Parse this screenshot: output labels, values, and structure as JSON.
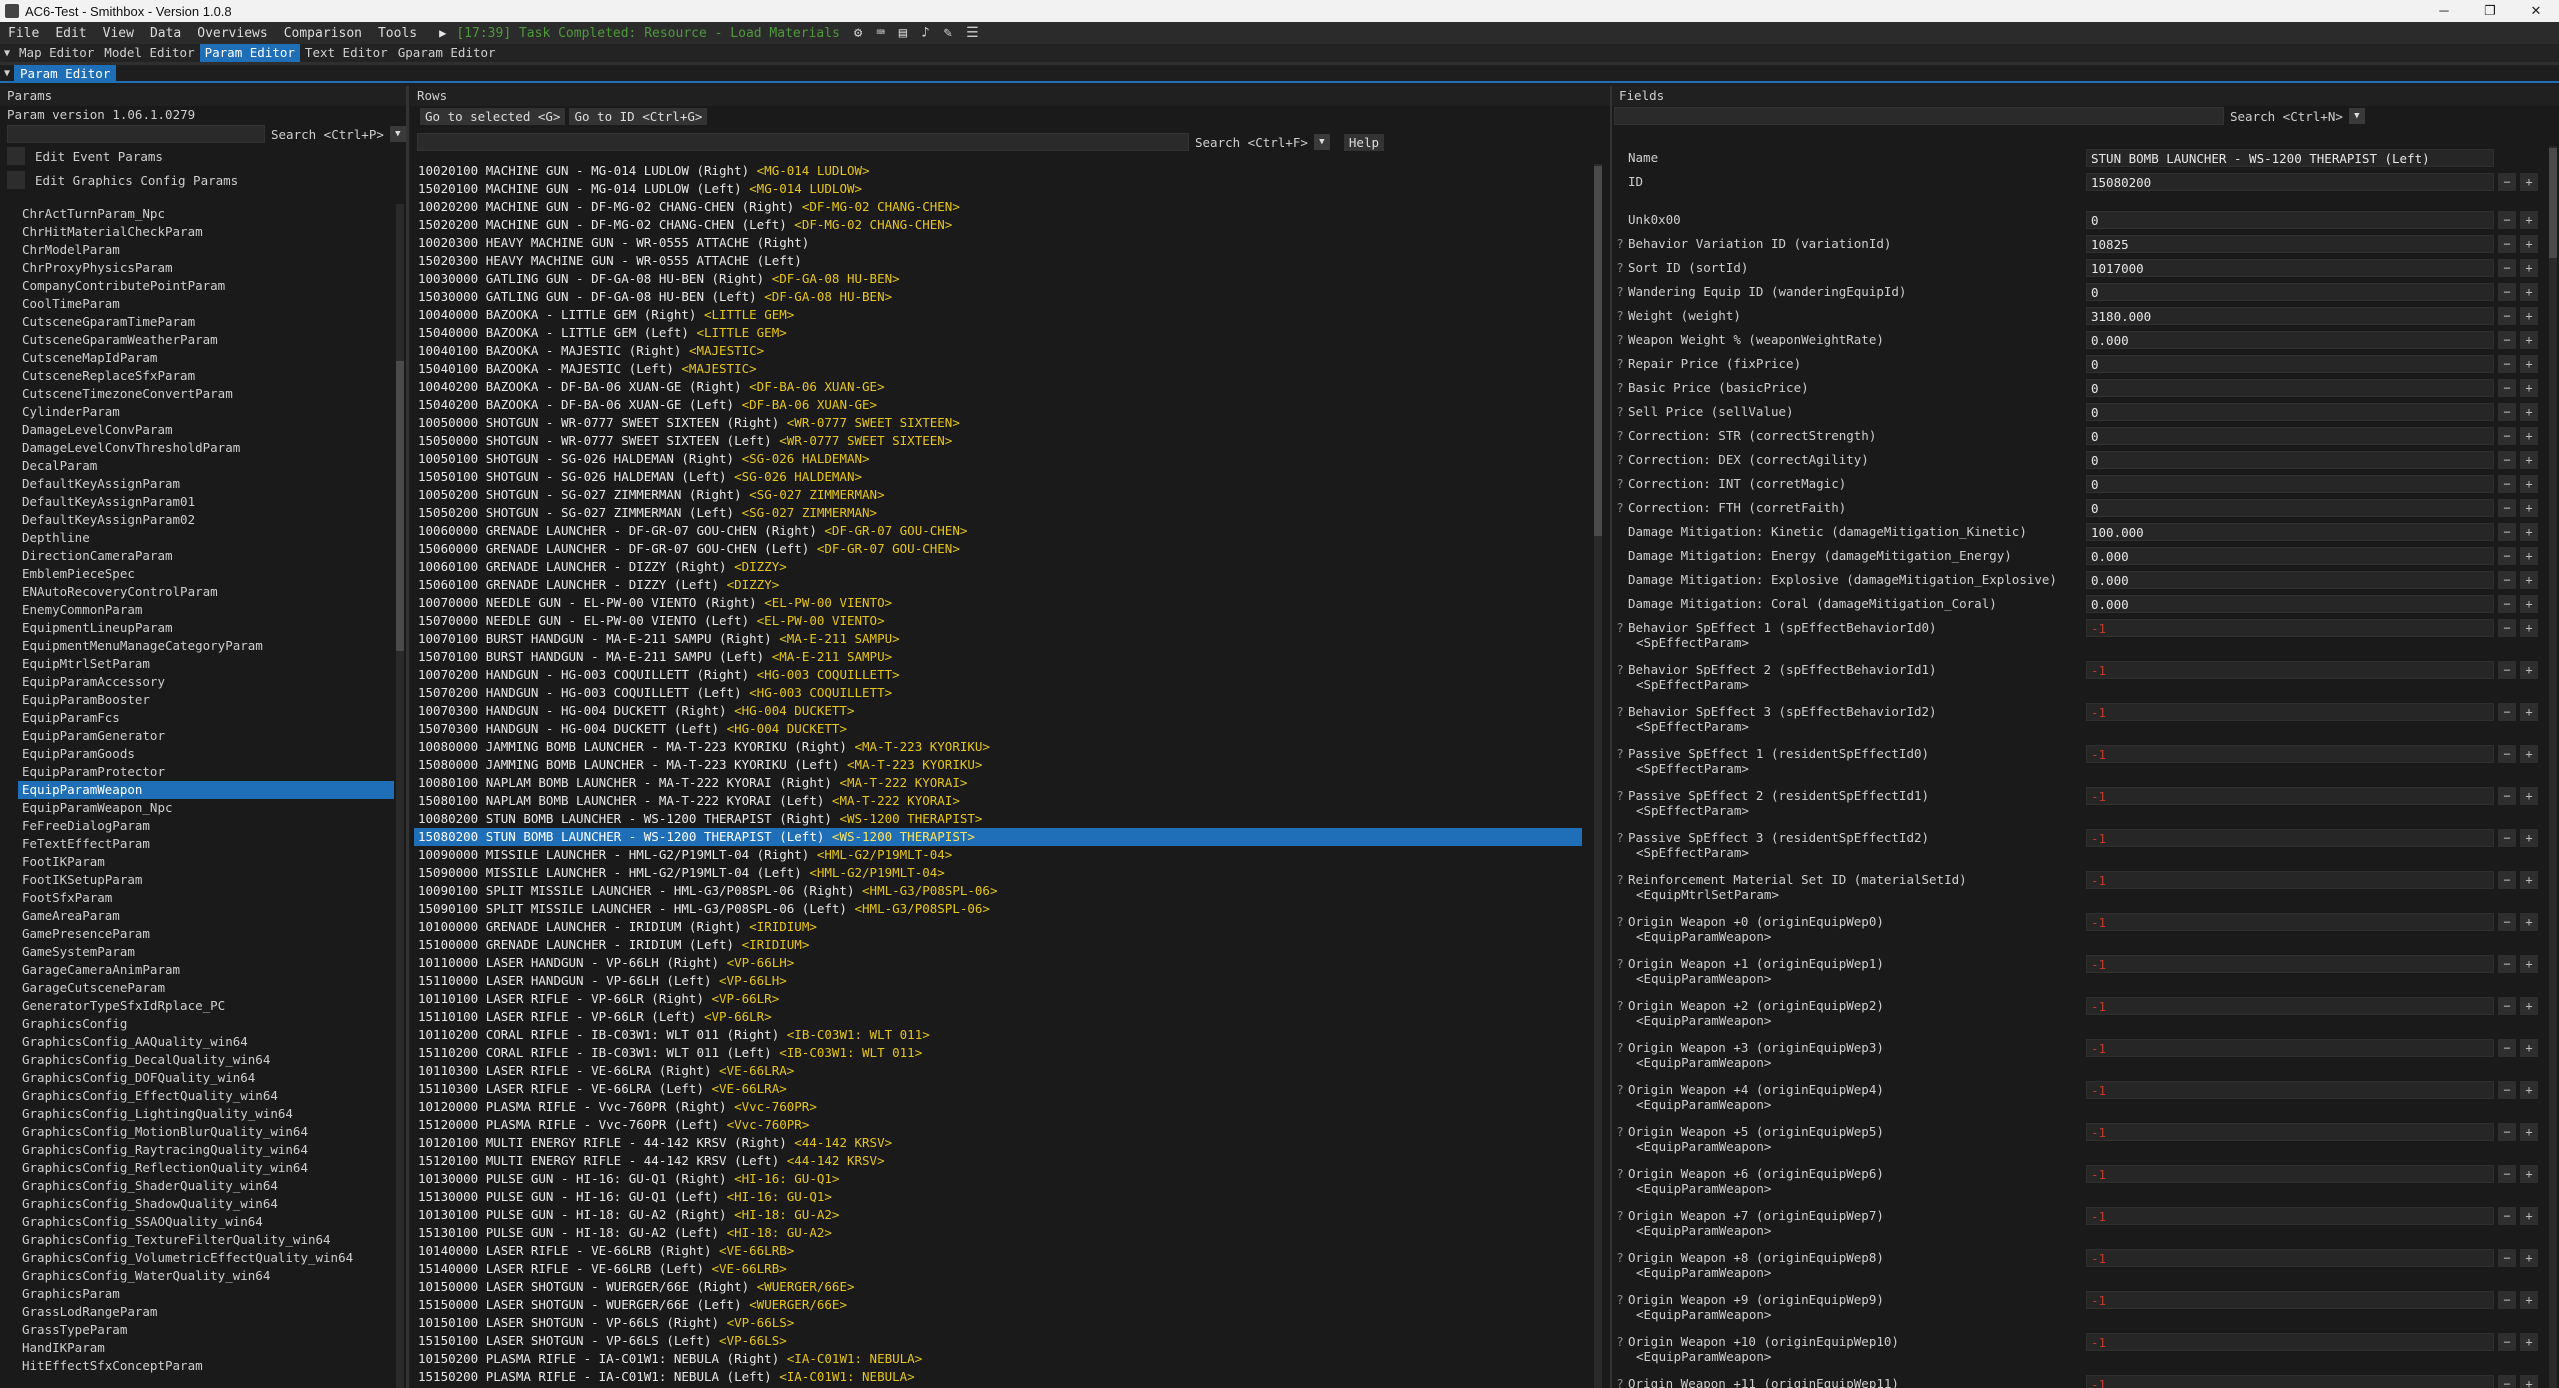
{
  "window": {
    "title": "AC6-Test - Smithbox - Version 1.0.8"
  },
  "menu": {
    "items": [
      "File",
      "Edit",
      "View",
      "Data",
      "Overviews",
      "Comparison",
      "Tools"
    ],
    "status": "[17:39] Task Completed: Resource - Load Materials"
  },
  "editors": {
    "tabs": [
      "Map Editor",
      "Model Editor",
      "Param Editor",
      "Text Editor",
      "Gparam Editor"
    ],
    "active": "Param Editor"
  },
  "subtab": "Param Editor",
  "params": {
    "title": "Params",
    "version": "Param version 1.06.1.0279",
    "search_label": "Search <Ctrl+P>",
    "edit_event": "Edit Event Params",
    "edit_graphics": "Edit Graphics Config Params",
    "items": [
      "ChrActTurnParam_Npc",
      "ChrHitMaterialCheckParam",
      "ChrModelParam",
      "ChrProxyPhysicsParam",
      "CompanyContributePointParam",
      "CoolTimeParam",
      "CutsceneGparamTimeParam",
      "CutsceneGparamWeatherParam",
      "CutsceneMapIdParam",
      "CutsceneReplaceSfxParam",
      "CutsceneTimezoneConvertParam",
      "CylinderParam",
      "DamageLevelConvParam",
      "DamageLevelConvThresholdParam",
      "DecalParam",
      "DefaultKeyAssignParam",
      "DefaultKeyAssignParam01",
      "DefaultKeyAssignParam02",
      "Depthline",
      "DirectionCameraParam",
      "EmblemPieceSpec",
      "ENAutoRecoveryControlParam",
      "EnemyCommonParam",
      "EquipmentLineupParam",
      "EquipmentMenuManageCategoryParam",
      "EquipMtrlSetParam",
      "EquipParamAccessory",
      "EquipParamBooster",
      "EquipParamFcs",
      "EquipParamGenerator",
      "EquipParamGoods",
      "EquipParamProtector",
      "EquipParamWeapon",
      "EquipParamWeapon_Npc",
      "FeFreeDialogParam",
      "FeTextEffectParam",
      "FootIKParam",
      "FootIKSetupParam",
      "FootSfxParam",
      "GameAreaParam",
      "GamePresenceParam",
      "GameSystemParam",
      "GarageCameraAnimParam",
      "GarageCutsceneParam",
      "GeneratorTypeSfxIdRplace_PC",
      "GraphicsConfig",
      "GraphicsConfig_AAQuality_win64",
      "GraphicsConfig_DecalQuality_win64",
      "GraphicsConfig_DOFQuality_win64",
      "GraphicsConfig_EffectQuality_win64",
      "GraphicsConfig_LightingQuality_win64",
      "GraphicsConfig_MotionBlurQuality_win64",
      "GraphicsConfig_RaytracingQuality_win64",
      "GraphicsConfig_ReflectionQuality_win64",
      "GraphicsConfig_ShaderQuality_win64",
      "GraphicsConfig_ShadowQuality_win64",
      "GraphicsConfig_SSAOQuality_win64",
      "GraphicsConfig_TextureFilterQuality_win64",
      "GraphicsConfig_VolumetricEffectQuality_win64",
      "GraphicsConfig_WaterQuality_win64",
      "GraphicsParam",
      "GrassLodRangeParam",
      "GrassTypeParam",
      "HandIKParam",
      "HitEffectSfxConceptParam"
    ],
    "selected": "EquipParamWeapon"
  },
  "rows": {
    "title": "Rows",
    "goto_selected": "Go to selected <G>",
    "goto_id": "Go to ID <Ctrl+G>",
    "search_label": "Search <Ctrl+F>",
    "help": "Help",
    "selected_index": 37,
    "items": [
      [
        "10020100 MACHINE GUN - MG-014 LUDLOW (Right)",
        "<MG-014 LUDLOW>"
      ],
      [
        "15020100 MACHINE GUN - MG-014 LUDLOW (Left)",
        "<MG-014 LUDLOW>"
      ],
      [
        "10020200 MACHINE GUN - DF-MG-02 CHANG-CHEN (Right)",
        "<DF-MG-02 CHANG-CHEN>"
      ],
      [
        "15020200 MACHINE GUN - DF-MG-02 CHANG-CHEN (Left)",
        "<DF-MG-02 CHANG-CHEN>"
      ],
      [
        "10020300 HEAVY MACHINE GUN - WR-0555 ATTACHE (Right)",
        ""
      ],
      [
        "15020300 HEAVY MACHINE GUN - WR-0555 ATTACHE (Left)",
        ""
      ],
      [
        "10030000 GATLING GUN - DF-GA-08 HU-BEN (Right)",
        "<DF-GA-08 HU-BEN>"
      ],
      [
        "15030000 GATLING GUN - DF-GA-08 HU-BEN (Left)",
        "<DF-GA-08 HU-BEN>"
      ],
      [
        "10040000 BAZOOKA - LITTLE GEM (Right)",
        "<LITTLE GEM>"
      ],
      [
        "15040000 BAZOOKA - LITTLE GEM (Left)",
        "<LITTLE GEM>"
      ],
      [
        "10040100 BAZOOKA - MAJESTIC (Right)",
        "<MAJESTIC>"
      ],
      [
        "15040100 BAZOOKA - MAJESTIC (Left)",
        "<MAJESTIC>"
      ],
      [
        "10040200 BAZOOKA - DF-BA-06 XUAN-GE (Right)",
        "<DF-BA-06 XUAN-GE>"
      ],
      [
        "15040200 BAZOOKA - DF-BA-06 XUAN-GE (Left)",
        "<DF-BA-06 XUAN-GE>"
      ],
      [
        "10050000 SHOTGUN - WR-0777 SWEET SIXTEEN (Right)",
        "<WR-0777 SWEET SIXTEEN>"
      ],
      [
        "15050000 SHOTGUN - WR-0777 SWEET SIXTEEN (Left)",
        "<WR-0777 SWEET SIXTEEN>"
      ],
      [
        "10050100 SHOTGUN - SG-026 HALDEMAN (Right)",
        "<SG-026 HALDEMAN>"
      ],
      [
        "15050100 SHOTGUN - SG-026 HALDEMAN (Left)",
        "<SG-026 HALDEMAN>"
      ],
      [
        "10050200 SHOTGUN - SG-027 ZIMMERMAN (Right)",
        "<SG-027 ZIMMERMAN>"
      ],
      [
        "15050200 SHOTGUN - SG-027 ZIMMERMAN (Left)",
        "<SG-027 ZIMMERMAN>"
      ],
      [
        "10060000 GRENADE LAUNCHER - DF-GR-07 GOU-CHEN (Right)",
        "<DF-GR-07 GOU-CHEN>"
      ],
      [
        "15060000 GRENADE LAUNCHER - DF-GR-07 GOU-CHEN (Left)",
        "<DF-GR-07 GOU-CHEN>"
      ],
      [
        "10060100 GRENADE LAUNCHER - DIZZY (Right)",
        "<DIZZY>"
      ],
      [
        "15060100 GRENADE LAUNCHER - DIZZY (Left)",
        "<DIZZY>"
      ],
      [
        "10070000 NEEDLE GUN - EL-PW-00 VIENTO (Right)",
        "<EL-PW-00 VIENTO>"
      ],
      [
        "15070000 NEEDLE GUN - EL-PW-00 VIENTO (Left)",
        "<EL-PW-00 VIENTO>"
      ],
      [
        "10070100 BURST HANDGUN - MA-E-211 SAMPU (Right)",
        "<MA-E-211 SAMPU>"
      ],
      [
        "15070100 BURST HANDGUN - MA-E-211 SAMPU (Left)",
        "<MA-E-211 SAMPU>"
      ],
      [
        "10070200 HANDGUN - HG-003 COQUILLETT (Right)",
        "<HG-003 COQUILLETT>"
      ],
      [
        "15070200 HANDGUN - HG-003 COQUILLETT (Left)",
        "<HG-003 COQUILLETT>"
      ],
      [
        "10070300 HANDGUN - HG-004 DUCKETT (Right)",
        "<HG-004 DUCKETT>"
      ],
      [
        "15070300 HANDGUN - HG-004 DUCKETT (Left)",
        "<HG-004 DUCKETT>"
      ],
      [
        "10080000 JAMMING BOMB LAUNCHER - MA-T-223 KYORIKU (Right)",
        "<MA-T-223 KYORIKU>"
      ],
      [
        "15080000 JAMMING BOMB LAUNCHER - MA-T-223 KYORIKU (Left)",
        "<MA-T-223 KYORIKU>"
      ],
      [
        "10080100 NAPLAM BOMB LAUNCHER - MA-T-222 KYORAI (Right)",
        "<MA-T-222 KYORAI>"
      ],
      [
        "15080100 NAPLAM BOMB LAUNCHER - MA-T-222 KYORAI (Left)",
        "<MA-T-222 KYORAI>"
      ],
      [
        "10080200 STUN BOMB LAUNCHER - WS-1200 THERAPIST (Right)",
        "<WS-1200 THERAPIST>"
      ],
      [
        "15080200 STUN BOMB LAUNCHER - WS-1200 THERAPIST (Left)",
        "<WS-1200 THERAPIST>"
      ],
      [
        "10090000 MISSILE LAUNCHER - HML-G2/P19MLT-04 (Right)",
        "<HML-G2/P19MLT-04>"
      ],
      [
        "15090000 MISSILE LAUNCHER - HML-G2/P19MLT-04 (Left)",
        "<HML-G2/P19MLT-04>"
      ],
      [
        "10090100 SPLIT MISSILE LAUNCHER - HML-G3/P08SPL-06 (Right)",
        "<HML-G3/P08SPL-06>"
      ],
      [
        "15090100 SPLIT MISSILE LAUNCHER - HML-G3/P08SPL-06 (Left)",
        "<HML-G3/P08SPL-06>"
      ],
      [
        "10100000 GRENADE LAUNCHER - IRIDIUM (Right)",
        "<IRIDIUM>"
      ],
      [
        "15100000 GRENADE LAUNCHER - IRIDIUM (Left)",
        "<IRIDIUM>"
      ],
      [
        "10110000 LASER HANDGUN - VP-66LH (Right)",
        "<VP-66LH>"
      ],
      [
        "15110000 LASER HANDGUN - VP-66LH (Left)",
        "<VP-66LH>"
      ],
      [
        "10110100 LASER RIFLE - VP-66LR (Right)",
        "<VP-66LR>"
      ],
      [
        "15110100 LASER RIFLE - VP-66LR (Left)",
        "<VP-66LR>"
      ],
      [
        "10110200 CORAL RIFLE - IB-C03W1: WLT 011 (Right)",
        "<IB-C03W1: WLT 011>"
      ],
      [
        "15110200 CORAL RIFLE - IB-C03W1: WLT 011 (Left)",
        "<IB-C03W1: WLT 011>"
      ],
      [
        "10110300 LASER RIFLE - VE-66LRA (Right)",
        "<VE-66LRA>"
      ],
      [
        "15110300 LASER RIFLE - VE-66LRA (Left)",
        "<VE-66LRA>"
      ],
      [
        "10120000 PLASMA RIFLE - Vvc-760PR (Right)",
        "<Vvc-760PR>"
      ],
      [
        "15120000 PLASMA RIFLE - Vvc-760PR (Left)",
        "<Vvc-760PR>"
      ],
      [
        "10120100 MULTI ENERGY RIFLE - 44-142 KRSV (Right)",
        "<44-142 KRSV>"
      ],
      [
        "15120100 MULTI ENERGY RIFLE - 44-142 KRSV (Left)",
        "<44-142 KRSV>"
      ],
      [
        "10130000 PULSE GUN - HI-16: GU-Q1 (Right)",
        "<HI-16: GU-Q1>"
      ],
      [
        "15130000 PULSE GUN - HI-16: GU-Q1 (Left)",
        "<HI-16: GU-Q1>"
      ],
      [
        "10130100 PULSE GUN - HI-18: GU-A2 (Right)",
        "<HI-18: GU-A2>"
      ],
      [
        "15130100 PULSE GUN - HI-18: GU-A2 (Left)",
        "<HI-18: GU-A2>"
      ],
      [
        "10140000 LASER RIFLE - VE-66LRB (Right)",
        "<VE-66LRB>"
      ],
      [
        "15140000 LASER RIFLE - VE-66LRB (Left)",
        "<VE-66LRB>"
      ],
      [
        "10150000 LASER SHOTGUN - WUERGER/66E (Right)",
        "<WUERGER/66E>"
      ],
      [
        "15150000 LASER SHOTGUN - WUERGER/66E (Left)",
        "<WUERGER/66E>"
      ],
      [
        "10150100 LASER SHOTGUN - VP-66LS (Right)",
        "<VP-66LS>"
      ],
      [
        "15150100 LASER SHOTGUN - VP-66LS (Left)",
        "<VP-66LS>"
      ],
      [
        "10150200 PLASMA RIFLE - IA-C01W1: NEBULA (Right)",
        "<IA-C01W1: NEBULA>"
      ],
      [
        "15150200 PLASMA RIFLE - IA-C01W1: NEBULA (Left)",
        "<IA-C01W1: NEBULA>"
      ]
    ]
  },
  "fields": {
    "title": "Fields",
    "search_label": "Search <Ctrl+N>",
    "items": [
      {
        "q": "",
        "name": "Name",
        "sub": "",
        "value": "STUN BOMB LAUNCHER - WS-1200 THERAPIST (Left)",
        "btns": false
      },
      {
        "q": "",
        "name": "ID",
        "sub": "",
        "value": "15080200",
        "btns": true
      },
      {
        "q": "",
        "name": "",
        "sub": "",
        "value": "",
        "btns": false,
        "spacer": true
      },
      {
        "q": "",
        "name": "Unk0x00",
        "sub": "",
        "value": "0",
        "btns": true
      },
      {
        "q": "?",
        "name": "Behavior Variation ID (variationId)",
        "sub": "",
        "value": "10825",
        "btns": true
      },
      {
        "q": "?",
        "name": "Sort ID (sortId)",
        "sub": "",
        "value": "1017000",
        "btns": true
      },
      {
        "q": "?",
        "name": "Wandering Equip ID (wanderingEquipId)",
        "sub": "",
        "value": "0",
        "btns": true
      },
      {
        "q": "?",
        "name": "Weight (weight)",
        "sub": "",
        "value": "3180.000",
        "btns": true
      },
      {
        "q": "?",
        "name": "Weapon Weight % (weaponWeightRate)",
        "sub": "",
        "value": "0.000",
        "btns": true
      },
      {
        "q": "?",
        "name": "Repair Price (fixPrice)",
        "sub": "",
        "value": "0",
        "btns": true
      },
      {
        "q": "?",
        "name": "Basic Price (basicPrice)",
        "sub": "",
        "value": "0",
        "btns": true
      },
      {
        "q": "?",
        "name": "Sell Price (sellValue)",
        "sub": "",
        "value": "0",
        "btns": true
      },
      {
        "q": "?",
        "name": "Correction: STR (correctStrength)",
        "sub": "",
        "value": "0",
        "btns": true
      },
      {
        "q": "?",
        "name": "Correction: DEX (correctAgility)",
        "sub": "",
        "value": "0",
        "btns": true
      },
      {
        "q": "?",
        "name": "Correction: INT (corretMagic)",
        "sub": "",
        "value": "0",
        "btns": true
      },
      {
        "q": "?",
        "name": "Correction: FTH (corretFaith)",
        "sub": "",
        "value": "0",
        "btns": true
      },
      {
        "q": "",
        "name": "Damage Mitigation: Kinetic (damageMitigation_Kinetic)",
        "sub": "",
        "value": "100.000",
        "btns": true
      },
      {
        "q": "",
        "name": "Damage Mitigation: Energy (damageMitigation_Energy)",
        "sub": "",
        "value": "0.000",
        "btns": true
      },
      {
        "q": "",
        "name": "Damage Mitigation: Explosive (damageMitigation_Explosive)",
        "sub": "",
        "value": "0.000",
        "btns": true
      },
      {
        "q": "",
        "name": "Damage Mitigation: Coral (damageMitigation_Coral)",
        "sub": "",
        "value": "0.000",
        "btns": true
      },
      {
        "q": "?",
        "name": "Behavior SpEffect 1 (spEffectBehaviorId0)",
        "sub": "<SpEffectParam>",
        "value": "-1",
        "btns": true,
        "neg": true
      },
      {
        "q": "?",
        "name": "Behavior SpEffect 2 (spEffectBehaviorId1)",
        "sub": "<SpEffectParam>",
        "value": "-1",
        "btns": true,
        "neg": true
      },
      {
        "q": "?",
        "name": "Behavior SpEffect 3 (spEffectBehaviorId2)",
        "sub": "<SpEffectParam>",
        "value": "-1",
        "btns": true,
        "neg": true
      },
      {
        "q": "?",
        "name": "Passive SpEffect 1 (residentSpEffectId0)",
        "sub": "<SpEffectParam>",
        "value": "-1",
        "btns": true,
        "neg": true
      },
      {
        "q": "?",
        "name": "Passive SpEffect 2 (residentSpEffectId1)",
        "sub": "<SpEffectParam>",
        "value": "-1",
        "btns": true,
        "neg": true
      },
      {
        "q": "?",
        "name": "Passive SpEffect 3 (residentSpEffectId2)",
        "sub": "<SpEffectParam>",
        "value": "-1",
        "btns": true,
        "neg": true
      },
      {
        "q": "?",
        "name": "Reinforcement Material Set ID (materialSetId)",
        "sub": "<EquipMtrlSetParam>",
        "value": "-1",
        "btns": true,
        "neg": true
      },
      {
        "q": "?",
        "name": "Origin Weapon +0 (originEquipWep0)",
        "sub": "<EquipParamWeapon>",
        "value": "-1",
        "btns": true,
        "neg": true
      },
      {
        "q": "?",
        "name": "Origin Weapon +1 (originEquipWep1)",
        "sub": "<EquipParamWeapon>",
        "value": "-1",
        "btns": true,
        "neg": true
      },
      {
        "q": "?",
        "name": "Origin Weapon +2 (originEquipWep2)",
        "sub": "<EquipParamWeapon>",
        "value": "-1",
        "btns": true,
        "neg": true
      },
      {
        "q": "?",
        "name": "Origin Weapon +3 (originEquipWep3)",
        "sub": "<EquipParamWeapon>",
        "value": "-1",
        "btns": true,
        "neg": true
      },
      {
        "q": "?",
        "name": "Origin Weapon +4 (originEquipWep4)",
        "sub": "<EquipParamWeapon>",
        "value": "-1",
        "btns": true,
        "neg": true
      },
      {
        "q": "?",
        "name": "Origin Weapon +5 (originEquipWep5)",
        "sub": "<EquipParamWeapon>",
        "value": "-1",
        "btns": true,
        "neg": true
      },
      {
        "q": "?",
        "name": "Origin Weapon +6 (originEquipWep6)",
        "sub": "<EquipParamWeapon>",
        "value": "-1",
        "btns": true,
        "neg": true
      },
      {
        "q": "?",
        "name": "Origin Weapon +7 (originEquipWep7)",
        "sub": "<EquipParamWeapon>",
        "value": "-1",
        "btns": true,
        "neg": true
      },
      {
        "q": "?",
        "name": "Origin Weapon +8 (originEquipWep8)",
        "sub": "<EquipParamWeapon>",
        "value": "-1",
        "btns": true,
        "neg": true
      },
      {
        "q": "?",
        "name": "Origin Weapon +9 (originEquipWep9)",
        "sub": "<EquipParamWeapon>",
        "value": "-1",
        "btns": true,
        "neg": true
      },
      {
        "q": "?",
        "name": "Origin Weapon +10 (originEquipWep10)",
        "sub": "<EquipParamWeapon>",
        "value": "-1",
        "btns": true,
        "neg": true
      },
      {
        "q": "?",
        "name": "Origin Weapon +11 (originEquipWep11)",
        "sub": "",
        "value": "-1",
        "btns": true,
        "neg": true
      }
    ]
  }
}
